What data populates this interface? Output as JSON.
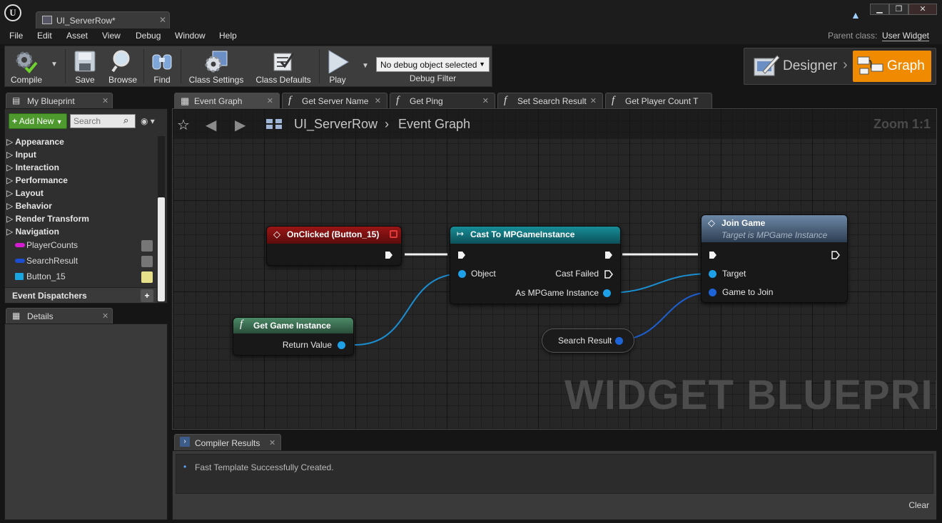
{
  "window": {
    "tab_title": "UI_ServerRow*",
    "minimize_glyph": "▁",
    "maximize_glyph": "❐",
    "close_glyph": "✕"
  },
  "menu": {
    "items": [
      "File",
      "Edit",
      "Asset",
      "View",
      "Debug",
      "Window",
      "Help"
    ],
    "parent_class_label": "Parent class:",
    "parent_class_value": "User Widget"
  },
  "toolbar": {
    "compile": "Compile",
    "save": "Save",
    "browse": "Browse",
    "find": "Find",
    "class_settings": "Class Settings",
    "class_defaults": "Class Defaults",
    "play": "Play",
    "debug_select": "No debug object selected",
    "debug_filter": "Debug Filter"
  },
  "modes": {
    "designer": "Designer",
    "graph": "Graph"
  },
  "my_blueprint": {
    "tab": "My Blueprint",
    "add_new": "Add New",
    "search_placeholder": "Search",
    "categories": [
      "Appearance",
      "Input",
      "Interaction",
      "Performance",
      "Layout",
      "Behavior",
      "Render Transform",
      "Navigation"
    ],
    "variables": [
      {
        "name": "PlayerCounts",
        "color": "#d21dd0"
      },
      {
        "name": "SearchResult",
        "color": "#1c4fd0"
      },
      {
        "name": "Button_15",
        "color": "#1aa6e0"
      }
    ],
    "event_dispatchers": "Event Dispatchers"
  },
  "details": {
    "tab": "Details"
  },
  "graph_tabs": [
    "Event Graph",
    "Get Server Name",
    "Get Ping",
    "Set Search Result",
    "Get Player Count T"
  ],
  "graph": {
    "breadcrumb_root": "UI_ServerRow",
    "breadcrumb_sep": "›",
    "breadcrumb_leaf": "Event Graph",
    "zoom": "Zoom 1:1",
    "watermark": "WIDGET BLUEPRINT",
    "nodes": {
      "onclicked": {
        "title": "OnClicked (Button_15)"
      },
      "cast": {
        "title": "Cast To MPGameInstance",
        "object": "Object",
        "cast_failed": "Cast Failed",
        "as_instance": "As MPGame Instance"
      },
      "join": {
        "title": "Join Game",
        "subtitle": "Target is MPGame Instance",
        "target": "Target",
        "game_to_join": "Game to Join"
      },
      "get_gi": {
        "title": "Get Game Instance",
        "return_value": "Return Value"
      },
      "search_var": {
        "label": "Search Result"
      }
    }
  },
  "compiler": {
    "tab": "Compiler Results",
    "message": "Fast Template Successfully Created.",
    "clear": "Clear"
  },
  "colors": {
    "event_header": "#8a1010",
    "cast_header": "#127f8a",
    "function_header": "#3d7a5a",
    "object_pin": "#1ea0e8",
    "struct_pin": "#1c64d8",
    "graph_mode_accent": "#f08a00"
  }
}
